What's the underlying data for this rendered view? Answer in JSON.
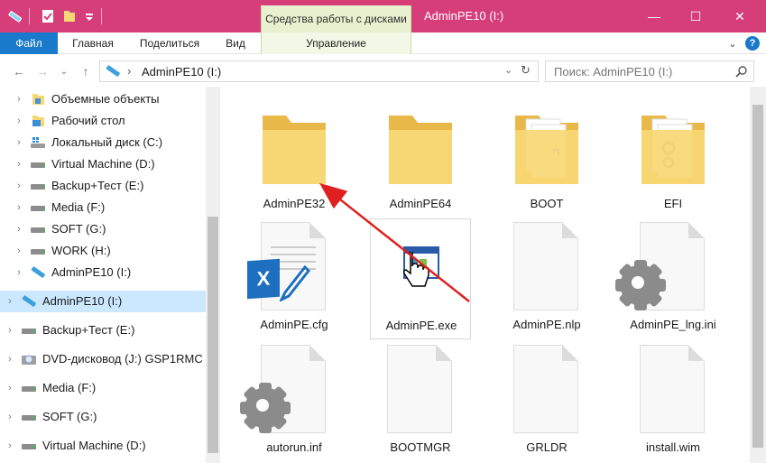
{
  "window": {
    "context_tab": "Средства работы с дисками",
    "title": "AdminPE10 (I:)",
    "minimize": "—",
    "maximize": "☐",
    "close": "✕"
  },
  "ribbon": {
    "tabs": [
      "Файл",
      "Главная",
      "Поделиться",
      "Вид",
      "Управление"
    ]
  },
  "address": {
    "path": "AdminPE10 (I:)",
    "search_placeholder": "Поиск: AdminPE10 (I:)"
  },
  "nav": {
    "items": [
      {
        "label": "Объемные объекты",
        "icon": "3d-objects-icon"
      },
      {
        "label": "Рабочий стол",
        "icon": "desktop-folder-icon"
      },
      {
        "label": "Локальный диск (C:)",
        "icon": "windows-drive-icon"
      },
      {
        "label": "Virtual Machine (D:)",
        "icon": "drive-icon"
      },
      {
        "label": "Backup+Тест (E:)",
        "icon": "drive-icon"
      },
      {
        "label": "Media (F:)",
        "icon": "drive-icon"
      },
      {
        "label": "SOFT (G:)",
        "icon": "drive-icon"
      },
      {
        "label": "WORK (H:)",
        "icon": "drive-icon"
      },
      {
        "label": "AdminPE10 (I:)",
        "icon": "usb-drive-icon"
      },
      {
        "label": "AdminPE10 (I:)",
        "icon": "usb-drive-icon"
      },
      {
        "label": "Backup+Тест (E:)",
        "icon": "drive-icon"
      },
      {
        "label": "DVD-дисковод (J:) GSP1RMC",
        "icon": "dvd-drive-icon"
      },
      {
        "label": "Media (F:)",
        "icon": "drive-icon"
      },
      {
        "label": "SOFT (G:)",
        "icon": "drive-icon"
      },
      {
        "label": "Virtual Machine (D:)",
        "icon": "drive-icon"
      }
    ]
  },
  "files": [
    {
      "name": "AdminPE32",
      "kind": "folder"
    },
    {
      "name": "AdminPE64",
      "kind": "folder"
    },
    {
      "name": "BOOT",
      "kind": "folder-docs"
    },
    {
      "name": "EFI",
      "kind": "folder-settings"
    },
    {
      "name": "AdminPE.cfg",
      "kind": "excel-doc"
    },
    {
      "name": "AdminPE.exe",
      "kind": "exe"
    },
    {
      "name": "AdminPE.nlp",
      "kind": "blank-doc"
    },
    {
      "name": "AdminPE_lng.ini",
      "kind": "settings-doc"
    },
    {
      "name": "autorun.inf",
      "kind": "settings-doc"
    },
    {
      "name": "BOOTMGR",
      "kind": "blank-doc"
    },
    {
      "name": "GRLDR",
      "kind": "blank-doc"
    },
    {
      "name": "install.wim",
      "kind": "blank-doc"
    }
  ],
  "colors": {
    "titlebar": "#d63e7a",
    "file_tab": "#1979ca",
    "selection": "#cce8ff",
    "folder": "#f2c94c",
    "arrow": "#e02020"
  }
}
